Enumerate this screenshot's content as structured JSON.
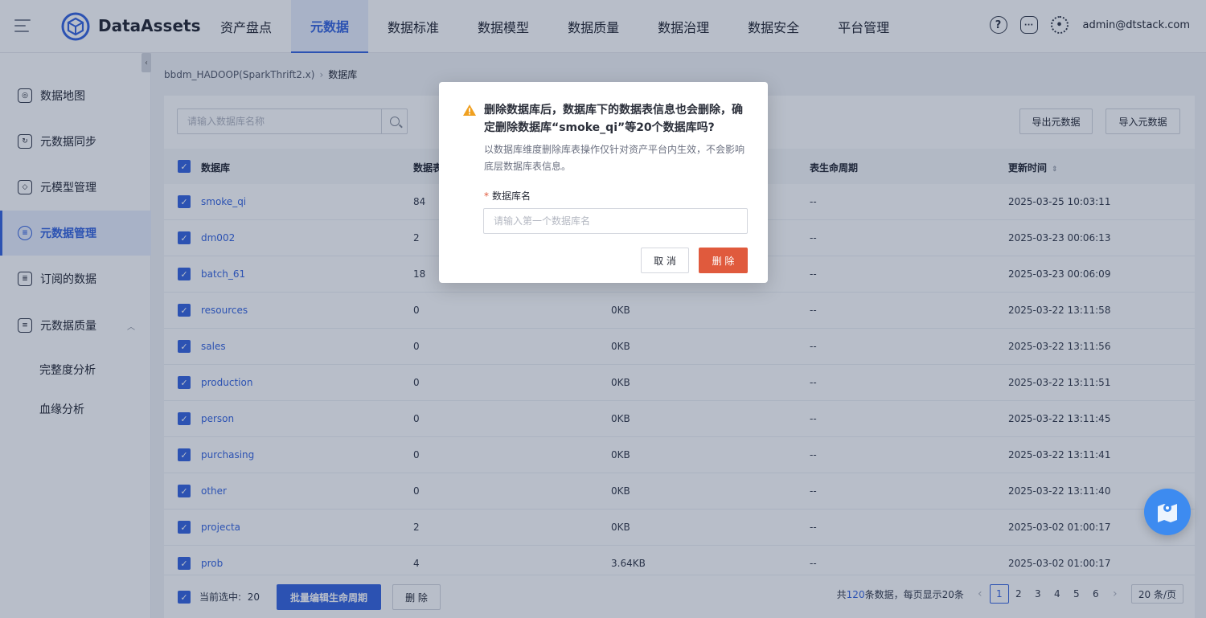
{
  "brand": "DataAssets",
  "nav": [
    "资产盘点",
    "元数据",
    "数据标准",
    "数据模型",
    "数据质量",
    "数据治理",
    "数据安全",
    "平台管理"
  ],
  "user": "admin@dtstack.com",
  "sidebar": {
    "items": [
      "数据地图",
      "元数据同步",
      "元模型管理",
      "元数据管理",
      "订阅的数据",
      "元数据质量"
    ],
    "subs": [
      "完整度分析",
      "血缘分析"
    ]
  },
  "breadcrumb": {
    "source": "bbdm_HADOOP(SparkThrift2.x)",
    "current": "数据库"
  },
  "toolbar": {
    "search_placeholder": "请输入数据库名称",
    "export_label": "导出元数据",
    "import_label": "导入元数据"
  },
  "table": {
    "headers": {
      "db": "数据库",
      "tables": "数据表",
      "lifecycle": "表生命周期",
      "updated": "更新时间"
    },
    "rows": [
      {
        "name": "smoke_qi",
        "tables": "84",
        "size": "",
        "lifecycle": "--",
        "updated": "2025-03-25 10:03:11"
      },
      {
        "name": "dm002",
        "tables": "2",
        "size": "",
        "lifecycle": "--",
        "updated": "2025-03-23 00:06:13"
      },
      {
        "name": "batch_61",
        "tables": "18",
        "size": "",
        "lifecycle": "--",
        "updated": "2025-03-23 00:06:09"
      },
      {
        "name": "resources",
        "tables": "0",
        "size": "0KB",
        "lifecycle": "--",
        "updated": "2025-03-22 13:11:58"
      },
      {
        "name": "sales",
        "tables": "0",
        "size": "0KB",
        "lifecycle": "--",
        "updated": "2025-03-22 13:11:56"
      },
      {
        "name": "production",
        "tables": "0",
        "size": "0KB",
        "lifecycle": "--",
        "updated": "2025-03-22 13:11:51"
      },
      {
        "name": "person",
        "tables": "0",
        "size": "0KB",
        "lifecycle": "--",
        "updated": "2025-03-22 13:11:45"
      },
      {
        "name": "purchasing",
        "tables": "0",
        "size": "0KB",
        "lifecycle": "--",
        "updated": "2025-03-22 13:11:41"
      },
      {
        "name": "other",
        "tables": "0",
        "size": "0KB",
        "lifecycle": "--",
        "updated": "2025-03-22 13:11:40"
      },
      {
        "name": "projecta",
        "tables": "2",
        "size": "0KB",
        "lifecycle": "--",
        "updated": "2025-03-02 01:00:17"
      },
      {
        "name": "prob",
        "tables": "4",
        "size": "3.64KB",
        "lifecycle": "--",
        "updated": "2025-03-02 01:00:17"
      }
    ]
  },
  "footer": {
    "selected_label": "当前选中:",
    "selected_count": "20",
    "batch_label": "批量编辑生命周期",
    "delete_label": "删 除",
    "total_prefix": "共",
    "total_count": "120",
    "total_suffix": "条数据，每页显示20条",
    "pages": [
      "1",
      "2",
      "3",
      "4",
      "5",
      "6"
    ],
    "page_size": "20 条/页"
  },
  "modal": {
    "title": "删除数据库后，数据库下的数据表信息也会删除，确定删除数据库“smoke_qi”等20个数据库吗?",
    "desc": "以数据库维度删除库表操作仅针对资产平台内生效，不会影响底层数据库表信息。",
    "field_label": "数据库名",
    "field_placeholder": "请输入第一个数据库名",
    "cancel_label": "取 消",
    "delete_label": "删 除"
  },
  "colors": {
    "accent": "#3d6ae0",
    "danger": "#e05a3d",
    "warning": "#f0a020"
  }
}
